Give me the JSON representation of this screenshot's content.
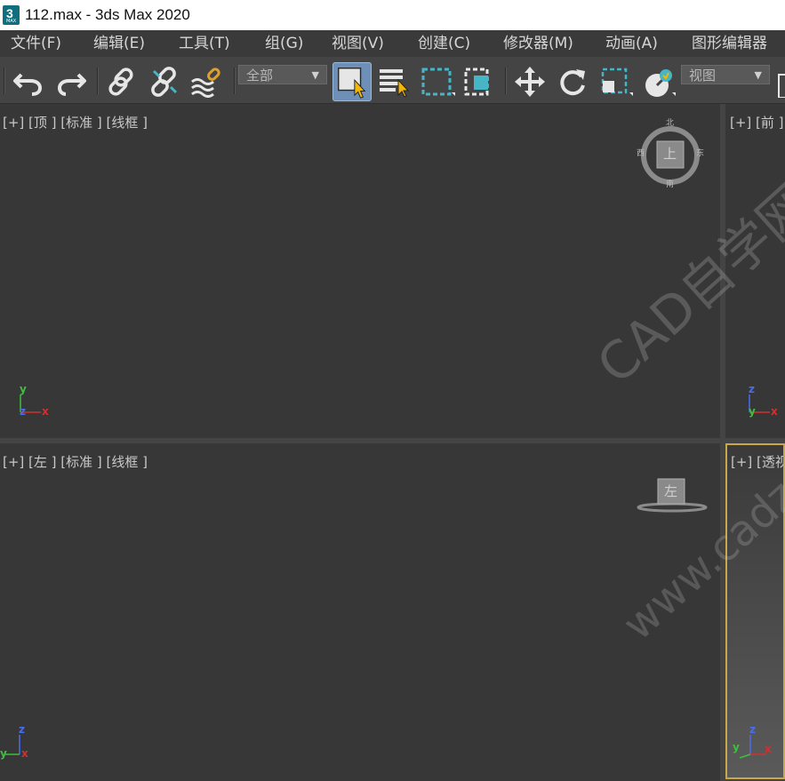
{
  "window": {
    "title": "112.max - 3ds Max 2020",
    "logo_number": "3",
    "logo_text": "MAX"
  },
  "menu": {
    "items": [
      "文件(F)",
      "编辑(E)",
      "工具(T)",
      "组(G)",
      "视图(V)",
      "创建(C)",
      "修改器(M)",
      "动画(A)",
      "图形编辑器"
    ]
  },
  "toolbar": {
    "selection_filter": "全部",
    "reference_coord": "视图",
    "accent_color": "#46b6c6",
    "active_color": "#6e8fb8"
  },
  "viewports": {
    "top": {
      "label": "[+] [顶 ] [标准 ] [线框 ]",
      "viewcube": {
        "face": "上",
        "north": "北",
        "south": "南",
        "east": "东",
        "west": "西"
      },
      "axes": {
        "a": "y",
        "b": "z",
        "c": "x"
      }
    },
    "front": {
      "label": "[+] [前 ]",
      "axes": {
        "a": "z",
        "b": "y",
        "c": "x"
      }
    },
    "left": {
      "label": "[+] [左 ] [标准 ] [线框 ]",
      "viewcube": {
        "face": "左"
      },
      "axes": {
        "a": "z",
        "b": "y",
        "c": "x"
      }
    },
    "perspective": {
      "label": "[+] [透视",
      "axes": {
        "a": "z",
        "b": "y",
        "c": "x"
      }
    }
  },
  "watermark": {
    "line1": "CAD自学网",
    "line2": "www.cadz"
  }
}
